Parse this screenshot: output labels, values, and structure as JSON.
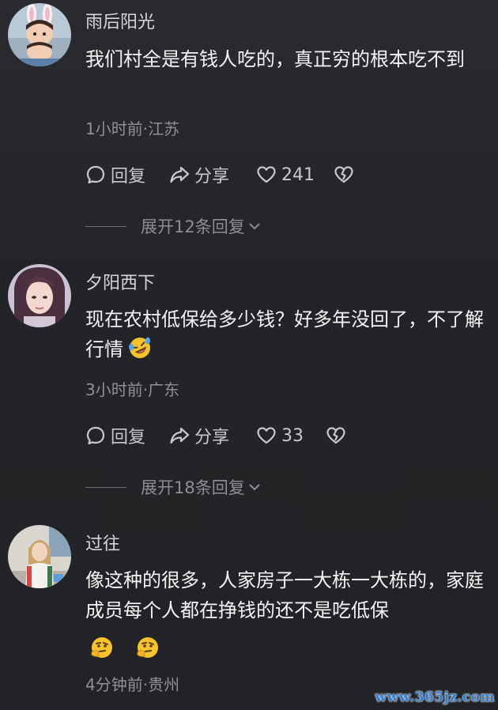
{
  "comments": [
    {
      "username": "雨后阳光",
      "text": "我们村全是有钱人吃的，真正穷的根本吃不到",
      "meta": "1小时前·江苏",
      "reply_label": "回复",
      "share_label": "分享",
      "likes": "241",
      "expand_label": "展开12条回复"
    },
    {
      "username": "夕阳西下",
      "text": "现在农村低保给多少钱？好多年没回了，不了解行情",
      "emoji": "rofl-emoji",
      "meta": "3小时前·广东",
      "reply_label": "回复",
      "share_label": "分享",
      "likes": "33",
      "expand_label": "展开18条回复"
    },
    {
      "username": "过往",
      "text": "像这种的很多，人家房子一大栋一大栋的，家庭成员每个人都在挣钱的还不是吃低保",
      "emojis": [
        "thinking-emoji",
        "thinking-emoji"
      ],
      "meta": "4分钟前·贵州"
    }
  ],
  "watermark": "www.365jz.com",
  "colors": {
    "background": "#232427",
    "text_primary": "#f4f4f5",
    "text_secondary": "#8f9095",
    "watermark": "#2f7fd6"
  }
}
